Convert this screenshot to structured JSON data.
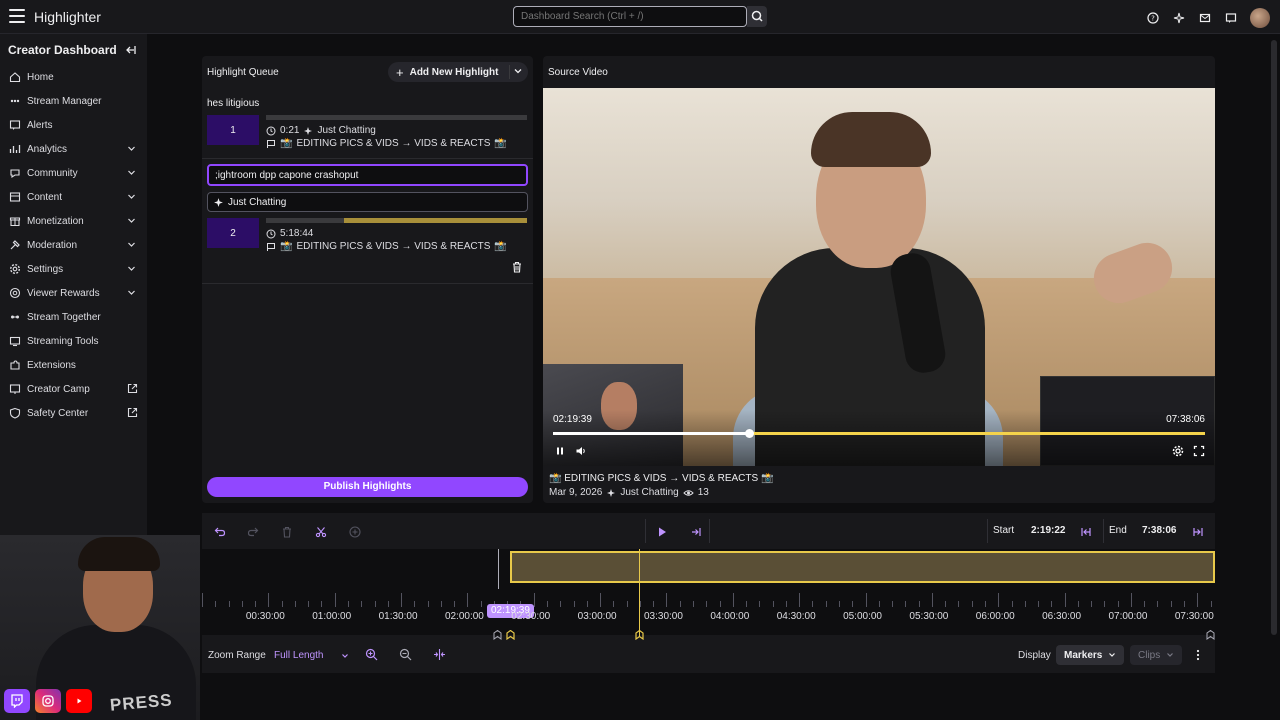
{
  "topbar": {
    "app_title": "Highlighter",
    "search_placeholder": "Dashboard Search (Ctrl + /)"
  },
  "sidebar": {
    "header": "Creator Dashboard",
    "items": [
      {
        "label": "Home",
        "icon": "home-icon",
        "has_chevron": false,
        "external": false
      },
      {
        "label": "Stream Manager",
        "icon": "stream-manager-icon",
        "has_chevron": false,
        "external": false
      },
      {
        "label": "Alerts",
        "icon": "alerts-icon",
        "has_chevron": false,
        "external": false
      },
      {
        "label": "Analytics",
        "icon": "analytics-icon",
        "has_chevron": true,
        "external": false
      },
      {
        "label": "Community",
        "icon": "community-icon",
        "has_chevron": true,
        "external": false
      },
      {
        "label": "Content",
        "icon": "content-icon",
        "has_chevron": true,
        "external": false
      },
      {
        "label": "Monetization",
        "icon": "monetization-icon",
        "has_chevron": true,
        "external": false
      },
      {
        "label": "Moderation",
        "icon": "moderation-icon",
        "has_chevron": true,
        "external": false
      },
      {
        "label": "Settings",
        "icon": "settings-icon",
        "has_chevron": true,
        "external": false
      },
      {
        "label": "Viewer Rewards",
        "icon": "viewer-rewards-icon",
        "has_chevron": true,
        "external": false
      },
      {
        "label": "Stream Together",
        "icon": "stream-together-icon",
        "has_chevron": false,
        "external": false
      },
      {
        "label": "Streaming Tools",
        "icon": "streaming-tools-icon",
        "has_chevron": false,
        "external": false
      },
      {
        "label": "Extensions",
        "icon": "extensions-icon",
        "has_chevron": false,
        "external": false
      },
      {
        "label": "Creator Camp",
        "icon": "creator-camp-icon",
        "has_chevron": false,
        "external": true
      },
      {
        "label": "Safety Center",
        "icon": "safety-center-icon",
        "has_chevron": false,
        "external": true
      }
    ]
  },
  "queue": {
    "title": "Highlight Queue",
    "add_button": "Add New Highlight",
    "highlights": [
      {
        "title": "hes litigious",
        "number": "1",
        "duration": "0:21",
        "category": "Just Chatting",
        "stream_title": "EDITING PICS & VIDS → VIDS & REACTS",
        "range_fraction": [
          0.0,
          0.0
        ]
      },
      {
        "number": "2",
        "duration": "5:18:44",
        "stream_title": "EDITING PICS & VIDS → VIDS & REACTS",
        "range_fraction": [
          0.3,
          1.0
        ]
      }
    ],
    "edit": {
      "title_value": ";ightroom dpp capone crashoput",
      "category_value": "Just Chatting"
    },
    "publish_button": "Publish Highlights"
  },
  "source_video": {
    "title": "Source Video",
    "current_time": "02:19:39",
    "end_time": "07:38:06",
    "progress_fraction": 0.3,
    "stream_title": "EDITING PICS & VIDS → VIDS & REACTS",
    "date": "Mar 9, 2026",
    "category": "Just Chatting",
    "views": "13"
  },
  "timeline": {
    "start_label": "Start",
    "start_value": "2:19:22",
    "end_label": "End",
    "end_value": "7:38:06",
    "playhead_label": "02:19:39",
    "ticks": [
      "00:30:00",
      "01:00:00",
      "01:30:00",
      "02:00:00",
      "02:30:00",
      "03:00:00",
      "03:30:00",
      "04:00:00",
      "04:30:00",
      "05:00:00",
      "05:30:00",
      "06:00:00",
      "06:30:00",
      "07:00:00",
      "07:30:00"
    ],
    "zoom_range_label": "Zoom Range",
    "zoom_range_value": "Full Length",
    "display_label": "Display",
    "markers_label": "Markers",
    "clips_label": "Clips"
  },
  "overlay": {
    "press_text": "PRESS"
  },
  "colors": {
    "accent": "#9147ff",
    "selection": "#e8c94a",
    "background": "#0e0e10",
    "panel": "#18181b"
  }
}
